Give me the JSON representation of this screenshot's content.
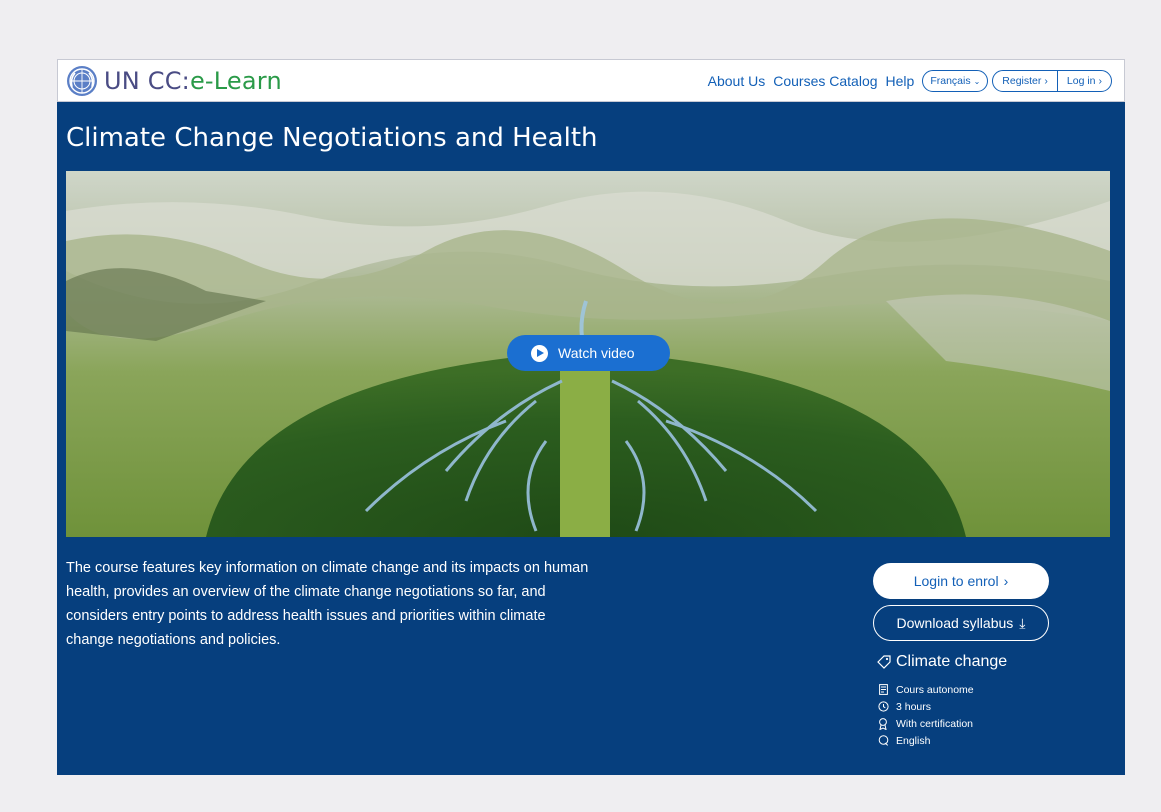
{
  "header": {
    "logo_text_un": "UN CC:",
    "logo_text_learn": "e-Learn",
    "nav": [
      "About Us",
      "Courses Catalog",
      "Help"
    ],
    "language": "Français",
    "register": "Register",
    "login": "Log in"
  },
  "course": {
    "title": "Climate Change Negotiations and Health",
    "watch_video": "Watch video",
    "description": "The course features key information on climate change and its impacts on human health, provides an overview of the climate change negotiations so far, and considers entry points to address health issues and priorities within climate change negotiations and policies.",
    "login_to_enrol": "Login to enrol",
    "download_syllabus": "Download syllabus",
    "tag": "Climate change",
    "meta": {
      "type": "Cours autonome",
      "duration": "3 hours",
      "certification": "With certification",
      "language": "English"
    }
  },
  "colors": {
    "brand_blue": "#063f7e",
    "link_blue": "#1360b7",
    "button_blue": "#1b6fd1",
    "logo_green": "#2a9a48"
  },
  "icons": {
    "logo": "un-emblem-icon",
    "watch": "play-circle-icon",
    "enrol": "chevron-right-icon",
    "syllabus": "download-icon",
    "tag": "tag-icon",
    "type": "document-icon",
    "duration": "clock-icon",
    "certification": "award-icon",
    "language": "speech-bubble-icon"
  }
}
